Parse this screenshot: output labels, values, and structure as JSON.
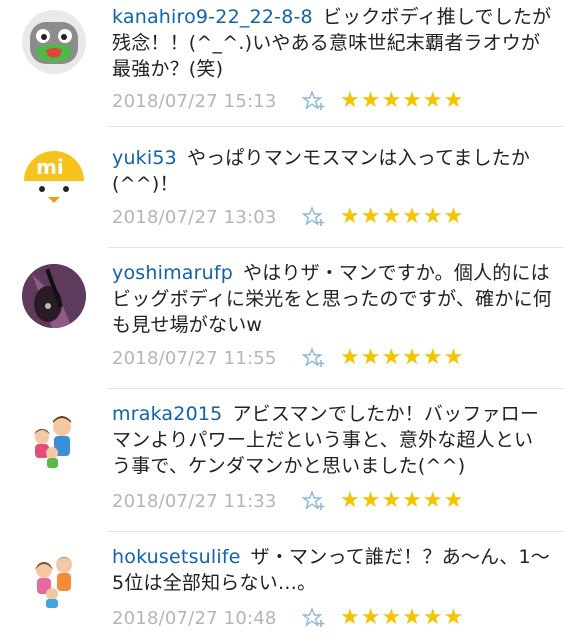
{
  "comments": [
    {
      "username": "kanahiro9-22_22-8-8",
      "message": "ビックボディ推しでしたが残念！！(^_^.)いやある意味世紀末覇者ラオウが最強か？(笑)",
      "timestamp": "2018/07/27 15:13",
      "rating": "★★★★★★",
      "avatar": "robot-face-avatar"
    },
    {
      "username": "yuki53",
      "message": "やっぱりマンモスマンは入ってましたか(^^)！",
      "timestamp": "2018/07/27 13:03",
      "rating": "★★★★★★",
      "avatar": "mi-chick-avatar"
    },
    {
      "username": "yoshimarufp",
      "message": "やはりザ・マンですか。個人的にはビッグボディに栄光をと思ったのですが、確かに何も見せ場がないw",
      "timestamp": "2018/07/27 11:55",
      "rating": "★★★★★★",
      "avatar": "guitar-photo-avatar"
    },
    {
      "username": "mraka2015",
      "message": "アビスマンでしたか！バッファローマンよりパワー上だという事と、意外な超人という事で、ケンダマンかと思いました(^^)",
      "timestamp": "2018/07/27 11:33",
      "rating": "★★★★★★",
      "avatar": "family-illustration-avatar"
    },
    {
      "username": "hokusetsulife",
      "message": "ザ・マンって誰だ！？あ～ん、1～5位は全部知らない…。",
      "timestamp": "2018/07/27 10:48",
      "rating": "★★★★★★",
      "avatar": "family-illustration-avatar"
    }
  ],
  "colors": {
    "username": "#0f63a8",
    "timestamp": "#b5b5b5",
    "stars": "#f5c400",
    "favorite_icon": "#8fb6dd",
    "divider": "#e3e3e3"
  }
}
